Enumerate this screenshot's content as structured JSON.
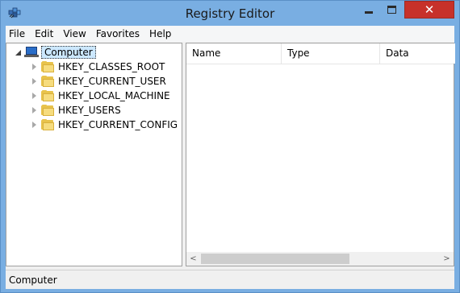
{
  "window": {
    "title": "Registry Editor",
    "app_icon": "registry-editor-icon",
    "close_glyph": "✕"
  },
  "menu": {
    "items": [
      "File",
      "Edit",
      "View",
      "Favorites",
      "Help"
    ]
  },
  "tree": {
    "root": {
      "label": "Computer",
      "icon": "computer-icon",
      "expanded": true
    },
    "children": [
      {
        "label": "HKEY_CLASSES_ROOT",
        "icon": "folder-icon"
      },
      {
        "label": "HKEY_CURRENT_USER",
        "icon": "folder-icon"
      },
      {
        "label": "HKEY_LOCAL_MACHINE",
        "icon": "folder-icon"
      },
      {
        "label": "HKEY_USERS",
        "icon": "folder-icon"
      },
      {
        "label": "HKEY_CURRENT_CONFIG",
        "icon": "folder-icon"
      }
    ]
  },
  "list": {
    "columns": [
      "Name",
      "Type",
      "Data"
    ]
  },
  "scroll": {
    "left_glyph": "<",
    "right_glyph": ">"
  },
  "status": {
    "text": "Computer"
  },
  "colors": {
    "titlebar": "#79aee2",
    "close_button": "#c7312a",
    "folder": "#e8c34c",
    "selection": "#cce8ff"
  }
}
